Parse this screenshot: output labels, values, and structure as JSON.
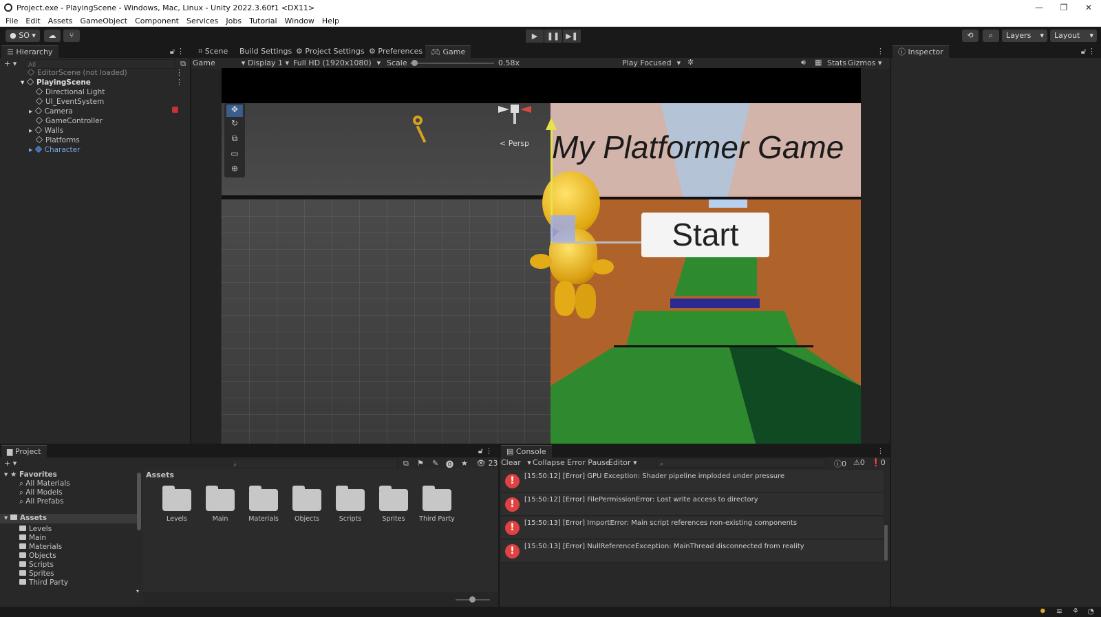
{
  "window": {
    "title": "Project.exe - PlayingScene - Windows, Mac, Linux - Unity 2022.3.60f1 <DX11>",
    "minimize": "—",
    "restore": "❐",
    "close": "✕"
  },
  "menu": [
    "File",
    "Edit",
    "Assets",
    "GameObject",
    "Component",
    "Services",
    "Jobs",
    "Tutorial",
    "Window",
    "Help"
  ],
  "toolbar": {
    "account": "SO",
    "layers": "Layers",
    "layout": "Layout"
  },
  "hierarchy": {
    "tab": "Hierarchy",
    "search_placeholder": "All",
    "items": [
      {
        "label": "EditorScene (not loaded)"
      },
      {
        "label": "PlayingScene"
      },
      {
        "label": "Directional Light"
      },
      {
        "label": "UI_EventSystem"
      },
      {
        "label": "Camera"
      },
      {
        "label": "GameController"
      },
      {
        "label": "Walls"
      },
      {
        "label": "Platforms"
      },
      {
        "label": "Character"
      }
    ]
  },
  "center_tabs": [
    "Scene",
    "Build Settings",
    "Project Settings",
    "Preferences",
    "Game"
  ],
  "game_toolbar": {
    "mode": "Game",
    "display": "Display 1",
    "resolution": "Full HD (1920x1080)",
    "scale_label": "Scale",
    "scale_value": "0.58x",
    "scale_fraction": 0.05,
    "play_mode": "Play Focused",
    "stats": "Stats",
    "gizmos": "Gizmos"
  },
  "scene": {
    "persp": "< Persp",
    "game_title": "My Platformer Game",
    "start_button": "Start"
  },
  "inspector": {
    "tab": "Inspector"
  },
  "project": {
    "tab": "Project",
    "count": "23",
    "favorites_label": "Favorites",
    "favorites": [
      "All Materials",
      "All Models",
      "All Prefabs"
    ],
    "assets_label": "Assets",
    "asset_folders": [
      "Levels",
      "Main",
      "Materials",
      "Objects",
      "Scripts",
      "Sprites",
      "Third Party"
    ],
    "breadcrumb": "Assets"
  },
  "console": {
    "tab": "Console",
    "clear": "Clear",
    "collapse": "Collapse",
    "error_pause": "Error Pause",
    "editor": "Editor",
    "log_count": "0",
    "warn_count": "0",
    "err_count": "0",
    "messages": [
      "[15:50:12] [Error] GPU Exception: Shader pipeline imploded under pressure",
      "[15:50:12] [Error] FilePermissionError: Lost write access to directory",
      "[15:50:13] [Error] ImportError: Main script references non-existing components",
      "[15:50:13] [Error] NullReferenceException: MainThread disconnected from reality"
    ]
  }
}
